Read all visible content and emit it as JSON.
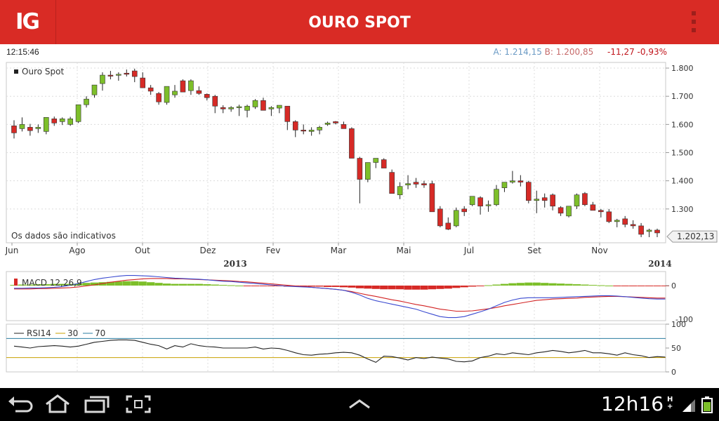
{
  "header": {
    "logo": "IG",
    "title": "OURO SPOT"
  },
  "info": {
    "time": "12:15:46",
    "ask_label": "A:",
    "ask_value": "1.214,15",
    "bid_label": "B:",
    "bid_value": "1.200,85",
    "change": "-11,27 -0,93%"
  },
  "chart_data": [
    {
      "type": "candlestick",
      "legend": "Ouro Spot",
      "note": "Os dados são indicativos",
      "ohlc": [
        [
          1595,
          1615,
          1550,
          1570
        ],
        [
          1585,
          1625,
          1575,
          1600
        ],
        [
          1590,
          1602,
          1560,
          1578
        ],
        [
          1585,
          1600,
          1570,
          1590
        ],
        [
          1575,
          1625,
          1565,
          1625
        ],
        [
          1620,
          1628,
          1595,
          1605
        ],
        [
          1610,
          1625,
          1598,
          1620
        ],
        [
          1600,
          1627,
          1595,
          1620
        ],
        [
          1610,
          1670,
          1605,
          1670
        ],
        [
          1670,
          1700,
          1660,
          1690
        ],
        [
          1705,
          1740,
          1695,
          1740
        ],
        [
          1745,
          1785,
          1720,
          1775
        ],
        [
          1775,
          1790,
          1760,
          1772
        ],
        [
          1778,
          1785,
          1755,
          1778
        ],
        [
          1782,
          1795,
          1770,
          1778
        ],
        [
          1790,
          1798,
          1750,
          1770
        ],
        [
          1765,
          1785,
          1735,
          1730
        ],
        [
          1730,
          1740,
          1705,
          1718
        ],
        [
          1710,
          1715,
          1670,
          1680
        ],
        [
          1678,
          1732,
          1670,
          1735
        ],
        [
          1705,
          1740,
          1695,
          1718
        ],
        [
          1755,
          1760,
          1720,
          1715
        ],
        [
          1720,
          1760,
          1705,
          1755
        ],
        [
          1720,
          1735,
          1705,
          1710
        ],
        [
          1707,
          1710,
          1685,
          1695
        ],
        [
          1700,
          1705,
          1640,
          1665
        ],
        [
          1660,
          1668,
          1640,
          1655
        ],
        [
          1655,
          1665,
          1645,
          1660
        ],
        [
          1662,
          1670,
          1630,
          1663
        ],
        [
          1650,
          1670,
          1625,
          1665
        ],
        [
          1662,
          1690,
          1655,
          1685
        ],
        [
          1685,
          1695,
          1660,
          1650
        ],
        [
          1655,
          1665,
          1630,
          1660
        ],
        [
          1658,
          1668,
          1640,
          1668
        ],
        [
          1665,
          1660,
          1580,
          1610
        ],
        [
          1610,
          1615,
          1555,
          1580
        ],
        [
          1580,
          1600,
          1565,
          1578
        ],
        [
          1575,
          1590,
          1560,
          1580
        ],
        [
          1580,
          1595,
          1565,
          1590
        ],
        [
          1600,
          1610,
          1595,
          1605
        ],
        [
          1610,
          1612,
          1600,
          1605
        ],
        [
          1600,
          1610,
          1588,
          1585
        ],
        [
          1585,
          1590,
          1480,
          1480
        ],
        [
          1480,
          1485,
          1320,
          1405
        ],
        [
          1405,
          1465,
          1395,
          1465
        ],
        [
          1465,
          1480,
          1445,
          1480
        ],
        [
          1475,
          1480,
          1445,
          1445
        ],
        [
          1430,
          1440,
          1355,
          1355
        ],
        [
          1350,
          1395,
          1335,
          1380
        ],
        [
          1385,
          1420,
          1370,
          1390
        ],
        [
          1395,
          1410,
          1375,
          1388
        ],
        [
          1390,
          1400,
          1375,
          1385
        ],
        [
          1390,
          1400,
          1375,
          1290
        ],
        [
          1300,
          1310,
          1235,
          1240
        ],
        [
          1250,
          1270,
          1225,
          1228
        ],
        [
          1240,
          1305,
          1235,
          1295
        ],
        [
          1300,
          1310,
          1275,
          1290
        ],
        [
          1315,
          1345,
          1310,
          1345
        ],
        [
          1340,
          1345,
          1280,
          1310
        ],
        [
          1315,
          1330,
          1290,
          1315
        ],
        [
          1315,
          1385,
          1310,
          1370
        ],
        [
          1375,
          1395,
          1360,
          1395
        ],
        [
          1395,
          1435,
          1390,
          1400
        ],
        [
          1400,
          1420,
          1380,
          1395
        ],
        [
          1395,
          1400,
          1320,
          1330
        ],
        [
          1330,
          1365,
          1285,
          1335
        ],
        [
          1340,
          1355,
          1305,
          1330
        ],
        [
          1350,
          1355,
          1295,
          1310
        ],
        [
          1305,
          1310,
          1275,
          1285
        ],
        [
          1275,
          1310,
          1270,
          1310
        ],
        [
          1310,
          1355,
          1300,
          1350
        ],
        [
          1355,
          1360,
          1310,
          1315
        ],
        [
          1315,
          1325,
          1300,
          1295
        ],
        [
          1295,
          1300,
          1270,
          1290
        ],
        [
          1290,
          1300,
          1250,
          1255
        ],
        [
          1255,
          1265,
          1235,
          1260
        ],
        [
          1265,
          1275,
          1235,
          1245
        ],
        [
          1245,
          1260,
          1230,
          1240
        ],
        [
          1240,
          1250,
          1200,
          1210
        ],
        [
          1220,
          1230,
          1200,
          1225
        ],
        [
          1225,
          1230,
          1200,
          1215
        ]
      ],
      "ylim": [
        1180,
        1820
      ],
      "yticks": [
        "1.800",
        "1.700",
        "1.600",
        "1.500",
        "1.400",
        "1.300"
      ],
      "last_price": "1.202,13",
      "xticks": [
        "Jun",
        "Ago",
        "Out",
        "Dez",
        "Fev",
        "Mar",
        "Mai",
        "Jul",
        "Set",
        "Nov"
      ],
      "years": [
        "2013",
        "2014"
      ]
    },
    {
      "type": "macd",
      "legend": "MACD 12,26,9",
      "histogram": [
        2,
        3,
        3,
        4,
        4,
        5,
        5,
        5,
        6,
        8,
        9,
        10,
        11,
        12,
        13,
        13,
        12,
        10,
        8,
        6,
        5,
        5,
        5,
        5,
        4,
        3,
        2,
        1,
        0,
        -1,
        -1,
        -2,
        -2,
        -2,
        -3,
        -3,
        -3,
        -3,
        -3,
        -4,
        -4,
        -5,
        -6,
        -8,
        -9,
        -10,
        -11,
        -11,
        -11,
        -12,
        -12,
        -12,
        -11,
        -10,
        -9,
        -7,
        -5,
        -3,
        -1,
        1,
        3,
        5,
        7,
        8,
        9,
        9,
        8,
        7,
        6,
        5,
        4,
        3,
        2,
        1,
        0,
        -1,
        -1,
        -2,
        -2,
        -2,
        -2,
        -2
      ],
      "macd": [
        -8,
        -8,
        -7,
        -7,
        -6,
        -5,
        -3,
        1,
        6,
        12,
        18,
        22,
        25,
        28,
        30,
        30,
        29,
        28,
        26,
        24,
        22,
        21,
        20,
        19,
        17,
        15,
        13,
        12,
        10,
        8,
        6,
        4,
        2,
        0,
        -2,
        -3,
        -4,
        -5,
        -7,
        -9,
        -11,
        -14,
        -20,
        -28,
        -38,
        -45,
        -50,
        -55,
        -60,
        -65,
        -70,
        -78,
        -85,
        -92,
        -95,
        -95,
        -92,
        -85,
        -78,
        -70,
        -60,
        -50,
        -43,
        -38,
        -36,
        -36,
        -36,
        -36,
        -35,
        -34,
        -33,
        -32,
        -31,
        -30,
        -30,
        -31,
        -33,
        -35,
        -37,
        -39,
        -40,
        -40
      ],
      "signal": [
        -10,
        -10,
        -10,
        -9,
        -9,
        -8,
        -7,
        -6,
        -4,
        -1,
        2,
        6,
        10,
        13,
        16,
        18,
        20,
        21,
        21,
        21,
        20,
        20,
        19,
        18,
        17,
        16,
        15,
        14,
        12,
        11,
        9,
        7,
        5,
        3,
        1,
        -1,
        -3,
        -5,
        -7,
        -9,
        -11,
        -14,
        -18,
        -23,
        -28,
        -32,
        -37,
        -42,
        -46,
        -51,
        -56,
        -60,
        -65,
        -70,
        -73,
        -76,
        -76,
        -75,
        -72,
        -69,
        -65,
        -60,
        -56,
        -52,
        -48,
        -44,
        -42,
        -40,
        -39,
        -38,
        -37,
        -35,
        -34,
        -33,
        -32,
        -32,
        -33,
        -34,
        -35,
        -36,
        -37,
        -37
      ],
      "yticks": [
        "0",
        "-100"
      ]
    },
    {
      "type": "rsi",
      "legend": [
        "RSI14",
        "30",
        "70"
      ],
      "values": [
        54,
        52,
        50,
        53,
        54,
        55,
        54,
        52,
        54,
        58,
        62,
        64,
        66,
        67,
        67,
        66,
        62,
        58,
        55,
        48,
        55,
        52,
        59,
        55,
        53,
        52,
        50,
        50,
        50,
        50,
        52,
        48,
        50,
        49,
        45,
        40,
        36,
        35,
        37,
        38,
        40,
        41,
        40,
        35,
        27,
        20,
        33,
        32,
        29,
        25,
        30,
        28,
        31,
        29,
        27,
        22,
        21,
        23,
        30,
        33,
        38,
        36,
        40,
        38,
        36,
        40,
        42,
        45,
        43,
        40,
        42,
        45,
        40,
        40,
        38,
        35,
        40,
        36,
        34,
        30,
        32,
        31
      ],
      "levels": [
        30,
        70
      ],
      "yticks": [
        "100",
        "50",
        "0"
      ]
    }
  ],
  "status_bar": {
    "clock": "12h16",
    "network": "H",
    "network_sub": "+"
  },
  "colors": {
    "up": "#7dbf2a",
    "down": "#d62a26",
    "header": "#d92b25",
    "macd": "#3a4ad0",
    "signal": "#d22222",
    "rsi": "#222222",
    "level30": "#c8a000",
    "level70": "#2a7ba0"
  }
}
